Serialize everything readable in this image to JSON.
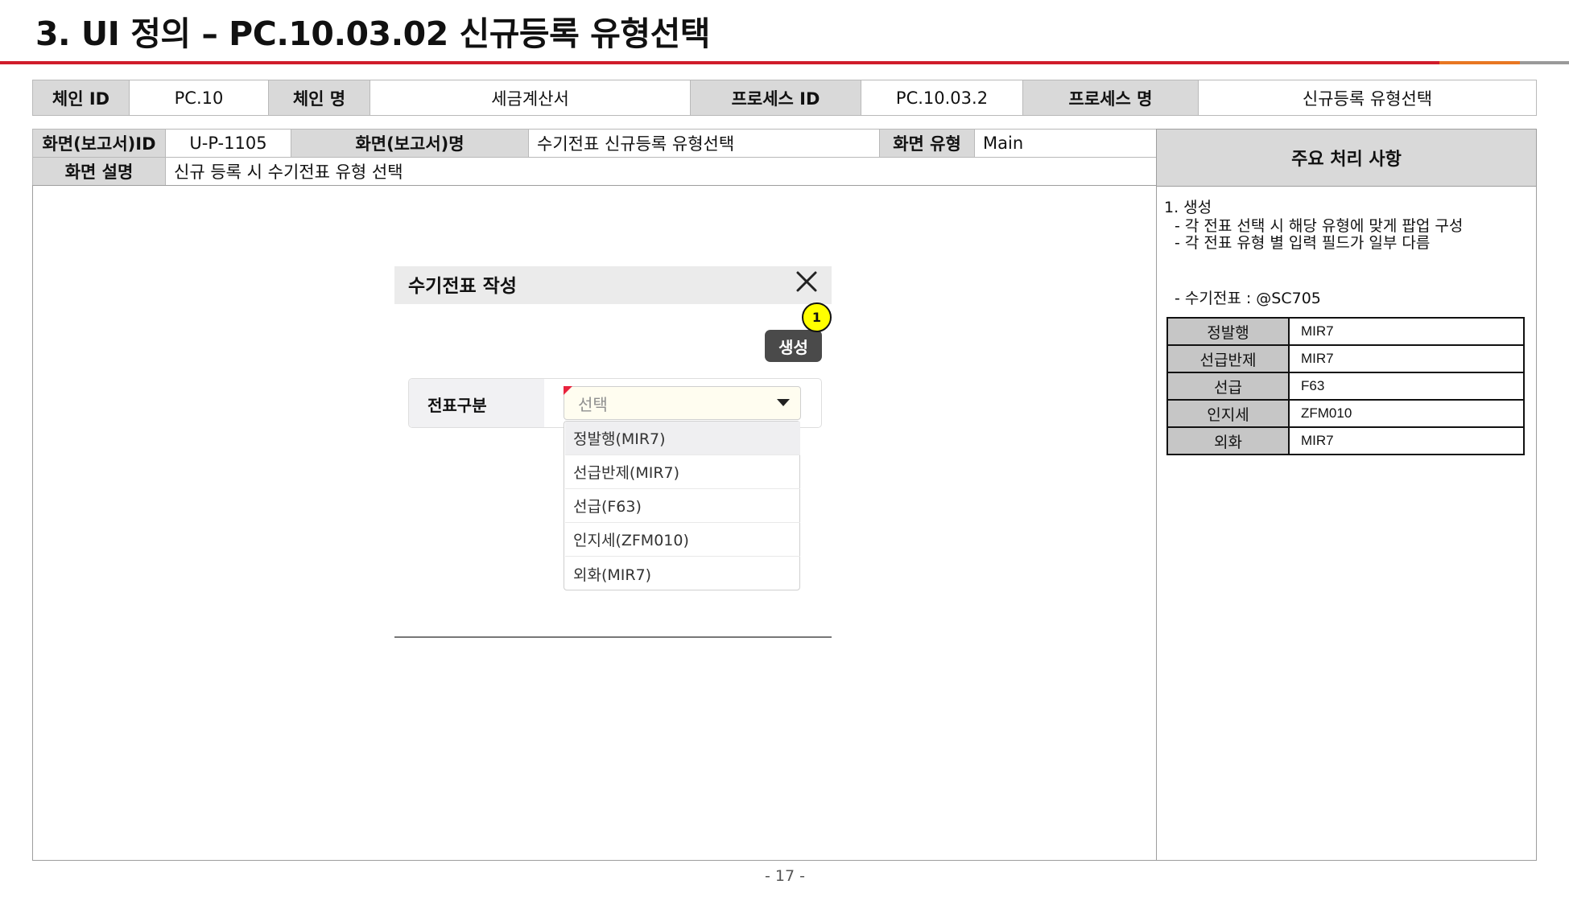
{
  "header": {
    "title": "3. UI 정의 – PC.10.03.02 신규등록 유형선택",
    "colors": {
      "rule": "#d01c2b",
      "accent_orange": "#e87722",
      "accent_gray": "#9a9a9a"
    }
  },
  "process_table": {
    "chain_id_label": "체인 ID",
    "chain_id": "PC.10",
    "chain_name_label": "체인 명",
    "chain_name": "세금계산서",
    "process_id_label": "프로세스 ID",
    "process_id": "PC.10.03.2",
    "process_name_label": "프로세스 명",
    "process_name": "신규등록 유형선택"
  },
  "screen_table": {
    "screen_id_label": "화면(보고서)ID",
    "screen_id": "U-P-1105",
    "screen_name_label": "화면(보고서)명",
    "screen_name": "수기전표 신규등록 유형선택",
    "screen_type_label": "화면 유형",
    "screen_type": "Main",
    "screen_desc_label": "화면 설명",
    "screen_desc": "신규 등록 시 수기전표 유형 선택"
  },
  "side_panel": {
    "title": "주요 처리 사항",
    "notes": [
      "1. 생성",
      "-    각 전표 선택 시 해당 유형에 맞게 팝업 구성",
      "-    각 전표 유형 별 입력 필드가 일부 다름",
      "-    수기전표 : @SC705"
    ],
    "mapping": [
      {
        "type": "정발행",
        "code": "MIR7"
      },
      {
        "type": "선급반제",
        "code": "MIR7"
      },
      {
        "type": "선급",
        "code": "F63"
      },
      {
        "type": "인지세",
        "code": "ZFM010"
      },
      {
        "type": "외화",
        "code": "MIR7"
      }
    ]
  },
  "popup": {
    "title": "수기전표 작성",
    "close_icon": "close-icon",
    "create_label": "생성",
    "callout": "1",
    "field_label": "전표구분",
    "select_placeholder": "선택",
    "options": [
      "정발행(MIR7)",
      "선급반제(MIR7)",
      "선급(F63)",
      "인지세(ZFM010)",
      "외화(MIR7)"
    ],
    "colors": {
      "required": "#e8233d",
      "badge": "#ffff00",
      "button": "#4a4a4a"
    }
  },
  "footer": {
    "page": "- 17 -"
  }
}
